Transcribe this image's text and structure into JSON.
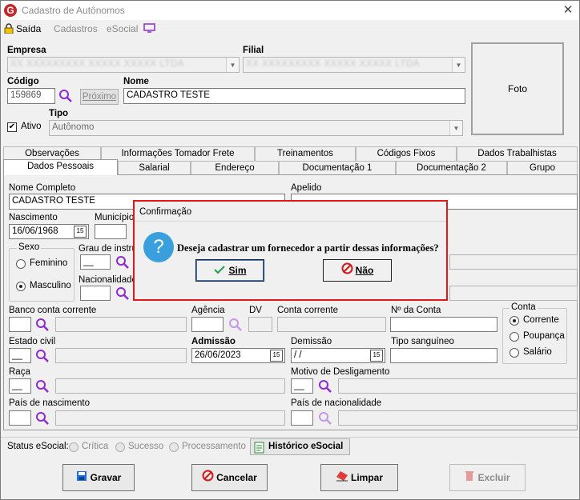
{
  "window": {
    "title": "Cadastro de Autônomos",
    "close_label": "✕"
  },
  "menu": {
    "exit_label": "Saída",
    "items": [
      "Cadastros",
      "eSocial"
    ]
  },
  "header": {
    "empresa_label": "Empresa",
    "empresa_value": "XX XXXXXXXXX XXXXX XXXXX LTDA",
    "filial_label": "Filial",
    "filial_value": "XX XXXXXXXXX XXXXX XXXXX LTDA",
    "codigo_label": "Código",
    "codigo_value": "159869",
    "proximo_label": "Próximo",
    "nome_label": "Nome",
    "nome_value": "CADASTRO TESTE",
    "ativo_label": "Ativo",
    "ativo_checked": true,
    "tipo_label": "Tipo",
    "tipo_value": "Autônomo",
    "foto_label": "Foto"
  },
  "tabs_row1": [
    "Observações",
    "Informações Tomador Frete",
    "Treinamentos",
    "Códigos Fixos",
    "Dados Trabalhistas"
  ],
  "tabs_row2": [
    "Dados Pessoais",
    "Salarial",
    "Endereço",
    "Documentação 1",
    "Documentação 2",
    "Grupo"
  ],
  "form": {
    "nome_completo_label": "Nome Completo",
    "nome_completo_value": "CADASTRO TESTE",
    "apelido_label": "Apelido",
    "nascimento_label": "Nascimento",
    "nascimento_value": "16/06/1968",
    "municipio_label": "Município",
    "sexo_label": "Sexo",
    "sexo_options": [
      "Feminino",
      "Masculino"
    ],
    "sexo_selected": "Masculino",
    "grau_label": "Grau de instrução",
    "nacionalidade_label": "Nacionalidade",
    "banco_label": "Banco conta corrente",
    "agencia_label": "Agência",
    "dv_label": "DV",
    "conta_corrente_label": "Conta corrente",
    "numero_conta_label": "Nº da Conta",
    "conta_group_label": "Conta",
    "conta_options": [
      "Corrente",
      "Poupança",
      "Salário"
    ],
    "conta_selected": "Corrente",
    "estado_civil_label": "Estado civil",
    "admissao_label": "Admissão",
    "admissao_value": "26/06/2023",
    "demissao_label": "Demissão",
    "demissao_value": " /  /",
    "tipo_sanguineo_label": "Tipo sanguíneo",
    "raca_label": "Raça",
    "motivo_label": "Motivo de Desligamento",
    "pais_nasc_label": "País de nascimento",
    "pais_nac_label": "País de nacionalidade",
    "blank_code": "__"
  },
  "status": {
    "label": "Status eSocial:",
    "items": [
      "Crítica",
      "Sucesso",
      "Processamento"
    ],
    "historico_label": "Histórico eSocial"
  },
  "buttons": {
    "gravar": "Gravar",
    "cancelar": "Cancelar",
    "limpar": "Limpar",
    "excluir": "Excluir"
  },
  "dialog": {
    "title": "Confirmação",
    "message": "Deseja cadastrar um fornecedor a partir dessas informações?",
    "yes": "Sim",
    "no": "Não"
  },
  "colors": {
    "dialog_border": "#e01818",
    "search_icon": "#8e2bd1",
    "ok_green": "#22a34a",
    "no_red": "#d11a1a",
    "question_blue": "#3aa0dd"
  }
}
